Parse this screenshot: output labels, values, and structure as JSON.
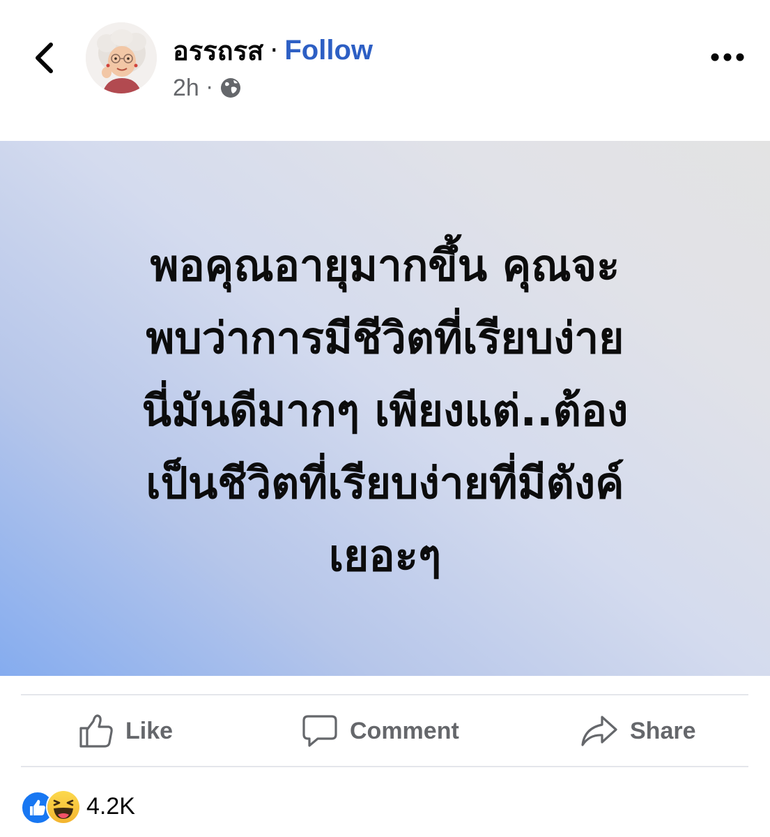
{
  "header": {
    "author_name": "อรรถรส",
    "separator": "·",
    "follow_label": "Follow",
    "time": "2h",
    "meta_separator": "·",
    "privacy_icon": "globe-icon",
    "more_icon": "ellipsis-icon"
  },
  "post": {
    "lines": [
      "พอคุณอายุมากขึ้น คุณจะ",
      "พบว่าการมีชีวิตที่เรียบง่าย",
      "นี่มันดีมากๆ เพียงแต่..ต้อง",
      "เป็นชีวิตที่เรียบง่ายที่มีตังค์",
      "เยอะๆ"
    ],
    "background_colors": [
      "#85acef",
      "#e3e3e3"
    ]
  },
  "actions": {
    "like_label": "Like",
    "comment_label": "Comment",
    "share_label": "Share"
  },
  "reactions": {
    "count": "4.2K",
    "types": [
      "like",
      "haha"
    ]
  },
  "colors": {
    "follow": "#2d5fc4",
    "muted": "#65676b",
    "like_blue": "#1877f2",
    "haha_yellow": "#f7c63a"
  }
}
